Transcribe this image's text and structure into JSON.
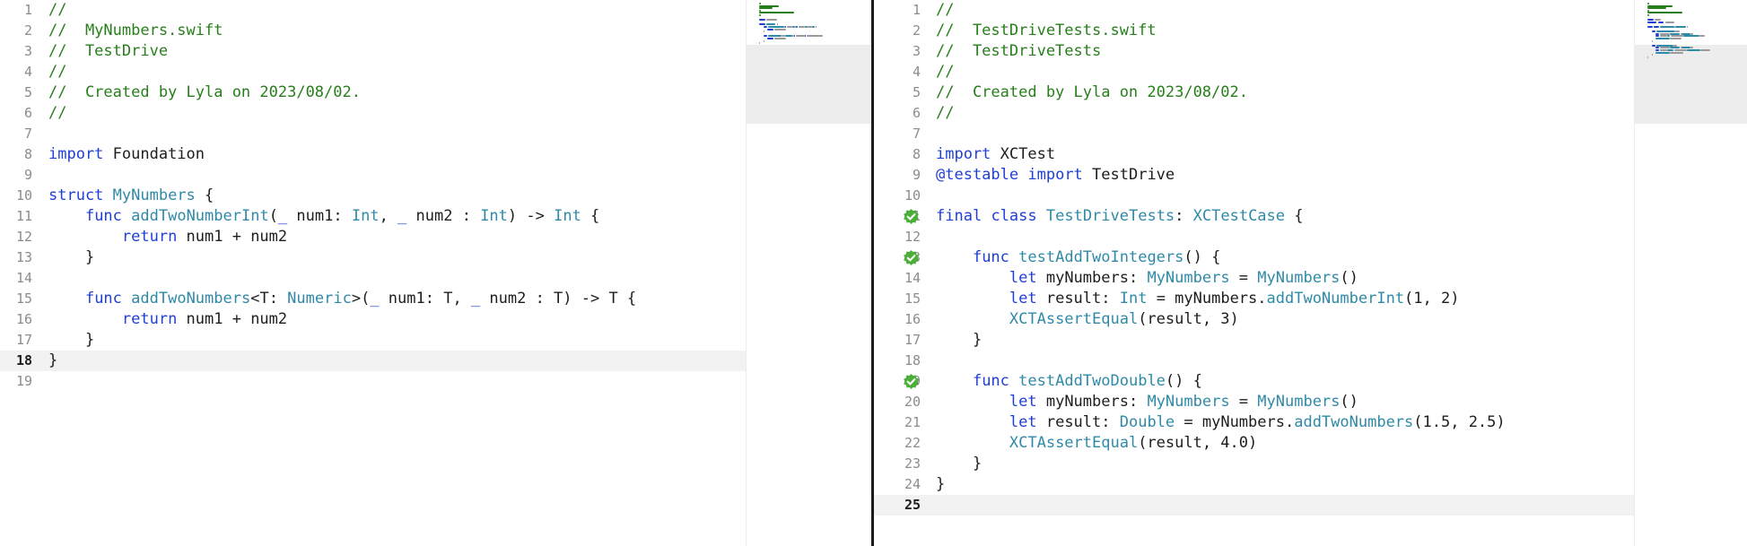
{
  "colors": {
    "comment": "#267f1a",
    "keyword": "#1f3fd6",
    "type": "#2f8aa8",
    "function": "#2f8aa8",
    "text": "#1d1d1f",
    "current_line": "#f2f2f2",
    "test_passed": "#4caf3a"
  },
  "left_editor": {
    "current_line": 18,
    "lines": [
      {
        "n": "1",
        "tokens": [
          [
            "cm",
            "//"
          ]
        ]
      },
      {
        "n": "2",
        "tokens": [
          [
            "cm",
            "//  MyNumbers.swift"
          ]
        ]
      },
      {
        "n": "3",
        "tokens": [
          [
            "cm",
            "//  TestDrive"
          ]
        ]
      },
      {
        "n": "4",
        "tokens": [
          [
            "cm",
            "//"
          ]
        ]
      },
      {
        "n": "5",
        "tokens": [
          [
            "cm",
            "//  Created by Lyla on 2023/08/02."
          ]
        ]
      },
      {
        "n": "6",
        "tokens": [
          [
            "cm",
            "//"
          ]
        ]
      },
      {
        "n": "7",
        "tokens": []
      },
      {
        "n": "8",
        "tokens": [
          [
            "kw",
            "import"
          ],
          [
            "tx",
            " Foundation"
          ]
        ]
      },
      {
        "n": "9",
        "tokens": []
      },
      {
        "n": "10",
        "tokens": [
          [
            "kw",
            "struct"
          ],
          [
            "tx",
            " "
          ],
          [
            "ty",
            "MyNumbers"
          ],
          [
            "tx",
            " {"
          ]
        ]
      },
      {
        "n": "11",
        "tokens": [
          [
            "tx",
            "    "
          ],
          [
            "kw",
            "func"
          ],
          [
            "tx",
            " "
          ],
          [
            "fn",
            "addTwoNumberInt"
          ],
          [
            "tx",
            "("
          ],
          [
            "kw",
            "_"
          ],
          [
            "tx",
            " num1: "
          ],
          [
            "ty",
            "Int"
          ],
          [
            "tx",
            ", "
          ],
          [
            "kw",
            "_"
          ],
          [
            "tx",
            " num2 : "
          ],
          [
            "ty",
            "Int"
          ],
          [
            "tx",
            ") -> "
          ],
          [
            "ty",
            "Int"
          ],
          [
            "tx",
            " {"
          ]
        ]
      },
      {
        "n": "12",
        "tokens": [
          [
            "tx",
            "        "
          ],
          [
            "kw",
            "return"
          ],
          [
            "tx",
            " num1 + num2"
          ]
        ]
      },
      {
        "n": "13",
        "tokens": [
          [
            "tx",
            "    }"
          ]
        ]
      },
      {
        "n": "14",
        "tokens": []
      },
      {
        "n": "15",
        "tokens": [
          [
            "tx",
            "    "
          ],
          [
            "kw",
            "func"
          ],
          [
            "tx",
            " "
          ],
          [
            "fn",
            "addTwoNumbers"
          ],
          [
            "tx",
            "<T: "
          ],
          [
            "ty",
            "Numeric"
          ],
          [
            "tx",
            ">("
          ],
          [
            "kw",
            "_"
          ],
          [
            "tx",
            " num1: T, "
          ],
          [
            "kw",
            "_"
          ],
          [
            "tx",
            " num2 : T) -> T {"
          ]
        ]
      },
      {
        "n": "16",
        "tokens": [
          [
            "tx",
            "        "
          ],
          [
            "kw",
            "return"
          ],
          [
            "tx",
            " num1 + num2"
          ]
        ]
      },
      {
        "n": "17",
        "tokens": [
          [
            "tx",
            "    }"
          ]
        ]
      },
      {
        "n": "18",
        "tokens": [
          [
            "tx",
            "}"
          ]
        ]
      },
      {
        "n": "19",
        "tokens": []
      }
    ]
  },
  "right_editor": {
    "current_line": 25,
    "lines": [
      {
        "n": "1",
        "tokens": [
          [
            "cm",
            "//"
          ]
        ]
      },
      {
        "n": "2",
        "tokens": [
          [
            "cm",
            "//  TestDriveTests.swift"
          ]
        ]
      },
      {
        "n": "3",
        "tokens": [
          [
            "cm",
            "//  TestDriveTests"
          ]
        ]
      },
      {
        "n": "4",
        "tokens": [
          [
            "cm",
            "//"
          ]
        ]
      },
      {
        "n": "5",
        "tokens": [
          [
            "cm",
            "//  Created by Lyla on 2023/08/02."
          ]
        ]
      },
      {
        "n": "6",
        "tokens": [
          [
            "cm",
            "//"
          ]
        ]
      },
      {
        "n": "7",
        "tokens": []
      },
      {
        "n": "8",
        "tokens": [
          [
            "kw",
            "import"
          ],
          [
            "tx",
            " XCTest"
          ]
        ]
      },
      {
        "n": "9",
        "tokens": [
          [
            "kw",
            "@testable"
          ],
          [
            "tx",
            " "
          ],
          [
            "kw",
            "import"
          ],
          [
            "tx",
            " TestDrive"
          ]
        ]
      },
      {
        "n": "10",
        "tokens": []
      },
      {
        "n": "11",
        "badge": "test-passed",
        "tokens": [
          [
            "kw",
            "final"
          ],
          [
            "tx",
            " "
          ],
          [
            "kw",
            "class"
          ],
          [
            "tx",
            " "
          ],
          [
            "ty",
            "TestDriveTests"
          ],
          [
            "tx",
            ": "
          ],
          [
            "ty",
            "XCTestCase"
          ],
          [
            "tx",
            " {"
          ]
        ]
      },
      {
        "n": "12",
        "tokens": []
      },
      {
        "n": "13",
        "badge": "test-passed",
        "tokens": [
          [
            "tx",
            "    "
          ],
          [
            "kw",
            "func"
          ],
          [
            "tx",
            " "
          ],
          [
            "fn",
            "testAddTwoIntegers"
          ],
          [
            "tx",
            "() {"
          ]
        ]
      },
      {
        "n": "14",
        "tokens": [
          [
            "tx",
            "        "
          ],
          [
            "kw",
            "let"
          ],
          [
            "tx",
            " myNumbers: "
          ],
          [
            "ty",
            "MyNumbers"
          ],
          [
            "tx",
            " = "
          ],
          [
            "ty",
            "MyNumbers"
          ],
          [
            "tx",
            "()"
          ]
        ]
      },
      {
        "n": "15",
        "tokens": [
          [
            "tx",
            "        "
          ],
          [
            "kw",
            "let"
          ],
          [
            "tx",
            " result: "
          ],
          [
            "ty",
            "Int"
          ],
          [
            "tx",
            " = myNumbers."
          ],
          [
            "fn",
            "addTwoNumberInt"
          ],
          [
            "tx",
            "(1, 2)"
          ]
        ]
      },
      {
        "n": "16",
        "tokens": [
          [
            "tx",
            "        "
          ],
          [
            "fn",
            "XCTAssertEqual"
          ],
          [
            "tx",
            "(result, 3)"
          ]
        ]
      },
      {
        "n": "17",
        "tokens": [
          [
            "tx",
            "    }"
          ]
        ]
      },
      {
        "n": "18",
        "tokens": []
      },
      {
        "n": "19",
        "badge": "test-passed",
        "tokens": [
          [
            "tx",
            "    "
          ],
          [
            "kw",
            "func"
          ],
          [
            "tx",
            " "
          ],
          [
            "fn",
            "testAddTwoDouble"
          ],
          [
            "tx",
            "() {"
          ]
        ]
      },
      {
        "n": "20",
        "tokens": [
          [
            "tx",
            "        "
          ],
          [
            "kw",
            "let"
          ],
          [
            "tx",
            " myNumbers: "
          ],
          [
            "ty",
            "MyNumbers"
          ],
          [
            "tx",
            " = "
          ],
          [
            "ty",
            "MyNumbers"
          ],
          [
            "tx",
            "()"
          ]
        ]
      },
      {
        "n": "21",
        "tokens": [
          [
            "tx",
            "        "
          ],
          [
            "kw",
            "let"
          ],
          [
            "tx",
            " result: "
          ],
          [
            "ty",
            "Double"
          ],
          [
            "tx",
            " = myNumbers."
          ],
          [
            "fn",
            "addTwoNumbers"
          ],
          [
            "tx",
            "(1.5, 2.5)"
          ]
        ]
      },
      {
        "n": "22",
        "tokens": [
          [
            "tx",
            "        "
          ],
          [
            "fn",
            "XCTAssertEqual"
          ],
          [
            "tx",
            "(result, 4.0)"
          ]
        ]
      },
      {
        "n": "23",
        "tokens": [
          [
            "tx",
            "    }"
          ]
        ]
      },
      {
        "n": "24",
        "tokens": [
          [
            "tx",
            "}"
          ]
        ]
      },
      {
        "n": "25",
        "tokens": []
      }
    ]
  }
}
